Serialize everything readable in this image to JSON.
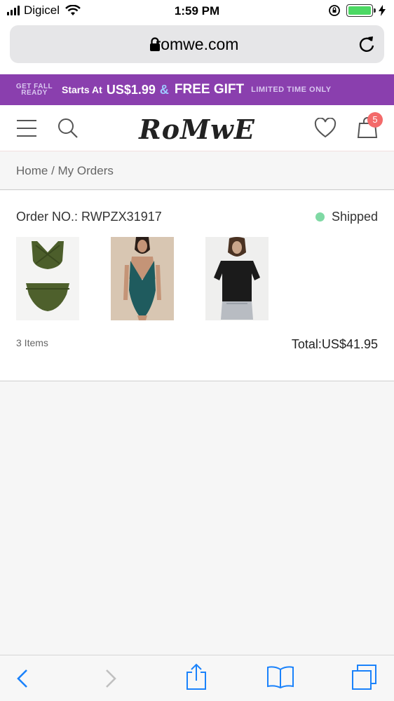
{
  "status_bar": {
    "carrier": "Digicel",
    "time": "1:59 PM",
    "battery_color": "#4cd964"
  },
  "browser": {
    "url": "romwe.com"
  },
  "promo": {
    "tag": "GET FALL READY",
    "starts": "Starts At",
    "price": "US$1.99",
    "amp": "&",
    "gift": "FREE GIFT",
    "limited": "LIMITED TIME ONLY",
    "background": "#8a3fae"
  },
  "header": {
    "logo": "RoMwE",
    "cart_count": "5"
  },
  "breadcrumb": "Home / My Orders",
  "order": {
    "number_label": "Order NO.: RWPZX31917",
    "status": "Shipped",
    "status_color": "#7fd9a4",
    "items": [
      {
        "name": "olive-bikini-image"
      },
      {
        "name": "teal-swimsuit-image"
      },
      {
        "name": "black-mesh-top-image"
      }
    ],
    "items_count": "3 Items",
    "total": "Total:US$41.95"
  }
}
